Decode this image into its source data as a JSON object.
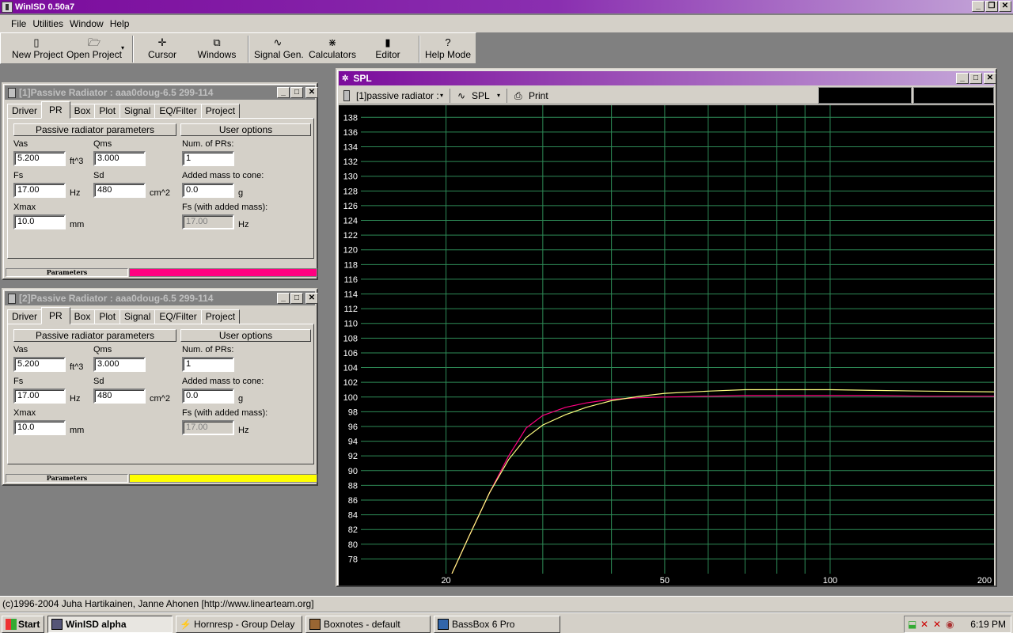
{
  "app": {
    "title": "WinISD 0.50a7"
  },
  "menu": [
    "File",
    "Utilities",
    "Window",
    "Help"
  ],
  "toolbar": [
    {
      "label": "New Project",
      "icon": "▯"
    },
    {
      "label": "Open Project",
      "icon": "🗁"
    },
    {
      "label": "Cursor",
      "icon": "✛"
    },
    {
      "label": "Windows",
      "icon": "⧉"
    },
    {
      "label": "Signal Gen.",
      "icon": "∿"
    },
    {
      "label": "Calculators",
      "icon": "⋇"
    },
    {
      "label": "Editor",
      "icon": "▮"
    },
    {
      "label": "Help Mode",
      "icon": "?"
    }
  ],
  "pr_windows": [
    {
      "title": "[1]Passive Radiator : aaa0doug-6.5 299-114",
      "bar_color": "#ff0080"
    },
    {
      "title": "[2]Passive Radiator : aaa0doug-6.5 299-114",
      "bar_color": "#ffff00"
    }
  ],
  "tabs": [
    "Driver",
    "PR",
    "Box",
    "Plot",
    "Signal",
    "EQ/Filter",
    "Project"
  ],
  "pr_labels": {
    "section_params": "Passive radiator parameters",
    "section_user": "User options",
    "vas": "Vas",
    "vas_value": "5.200",
    "vas_unit": "ft^3",
    "qms": "Qms",
    "qms_value": "3.000",
    "fs": "Fs",
    "fs_value": "17.00",
    "fs_unit": "Hz",
    "sd": "Sd",
    "sd_value": "480",
    "sd_unit": "cm^2",
    "xmax": "Xmax",
    "xmax_value": "10.0",
    "xmax_unit": "mm",
    "num_prs": "Num. of PRs:",
    "num_prs_value": "1",
    "added_mass": "Added mass to cone:",
    "added_mass_value": "0.0",
    "added_mass_unit": "g",
    "fs_added": "Fs (with added mass):",
    "fs_added_value": "17.00",
    "fs_added_unit": "Hz",
    "status_label": "Parameters"
  },
  "spl_window": {
    "title": "SPL",
    "project_select": "[1]passive radiator :",
    "plot_select": "SPL",
    "print_label": "Print"
  },
  "chart_data": {
    "type": "line",
    "x_scale": "log",
    "xlim": [
      14,
      200
    ],
    "ylim": [
      76,
      139
    ],
    "y_ticks": [
      78,
      80,
      82,
      84,
      86,
      88,
      90,
      92,
      94,
      96,
      98,
      100,
      102,
      104,
      106,
      108,
      110,
      112,
      114,
      116,
      118,
      120,
      122,
      124,
      126,
      128,
      130,
      132,
      134,
      136,
      138
    ],
    "x_tick_labels": [
      20,
      50,
      100,
      200
    ],
    "grid": true,
    "grid_color": "#2e8b57",
    "background": "#000000",
    "series": [
      {
        "color": "#ff0080",
        "x": [
          20.5,
          22,
          24,
          26,
          28,
          30,
          33,
          36,
          40,
          45,
          50,
          60,
          70,
          80,
          100,
          120,
          150,
          200
        ],
        "y": [
          76,
          81,
          87,
          92,
          95.8,
          97.5,
          98.6,
          99.2,
          99.7,
          99.9,
          100.0,
          100.1,
          100.2,
          100.2,
          100.2,
          100.2,
          100.1,
          100.1
        ]
      },
      {
        "color": "#ffff80",
        "x": [
          20.5,
          22,
          24,
          26,
          28,
          30,
          33,
          36,
          40,
          45,
          50,
          60,
          70,
          80,
          100,
          120,
          150,
          200
        ],
        "y": [
          76,
          81,
          87,
          91.5,
          94.5,
          96.2,
          97.6,
          98.6,
          99.5,
          100.1,
          100.5,
          100.8,
          101.0,
          101.0,
          101.0,
          100.9,
          100.8,
          100.7
        ]
      }
    ]
  },
  "status": "(c)1996-2004 Juha Hartikainen, Janne Ahonen [http://www.linearteam.org]",
  "taskbar": {
    "start": "Start",
    "tasks": [
      "WinISD alpha",
      "Hornresp - Group Delay",
      "Boxnotes - default",
      "BassBox 6 Pro"
    ],
    "clock": "6:19 PM"
  }
}
